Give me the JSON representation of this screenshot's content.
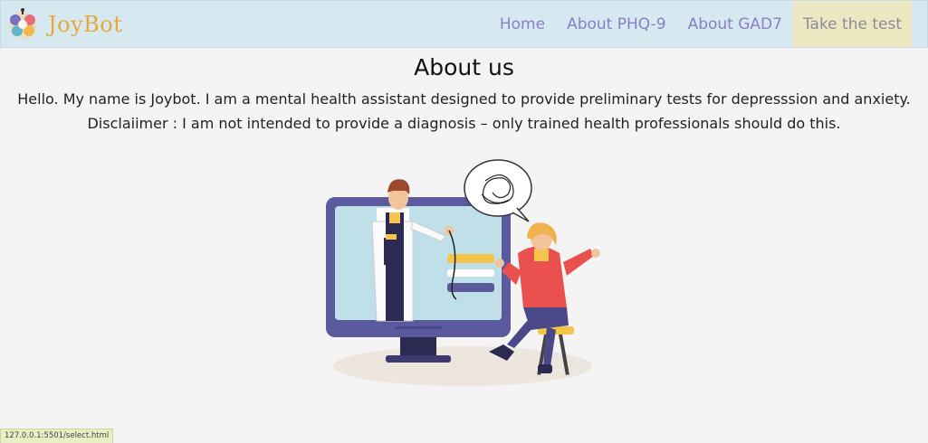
{
  "brand": {
    "name": "JoyBot"
  },
  "nav": {
    "items": [
      {
        "label": "Home"
      },
      {
        "label": "About PHQ-9"
      },
      {
        "label": "About GAD7"
      },
      {
        "label": "Take the test"
      }
    ]
  },
  "main": {
    "title": "About us",
    "intro": "Hello. My name is Joybot. I am a mental health assistant designed to provide preliminary tests for depresssion and anxiety.",
    "disclaimer": "Disclaiimer : I am not intended to provide a diagnosis – only trained health professionals should do this."
  },
  "illustration": {
    "icon": "doctor-consultation-illustration",
    "colors": {
      "monitor_frame": "#5c5a9e",
      "screen": "#bfe0e8",
      "accent_yellow": "#f5c44a",
      "jacket_red": "#e9504e",
      "floor_shadow": "#ece6df"
    }
  },
  "status_bar": {
    "url": "127.0.0.1:5501/select.html"
  },
  "colors": {
    "navbar_bg": "#d6e9f0",
    "brand": "#e8a93a",
    "nav_link": "#8a7fc4",
    "cta_bg": "#ece9c2",
    "page_bg": "#f4f4f4"
  }
}
